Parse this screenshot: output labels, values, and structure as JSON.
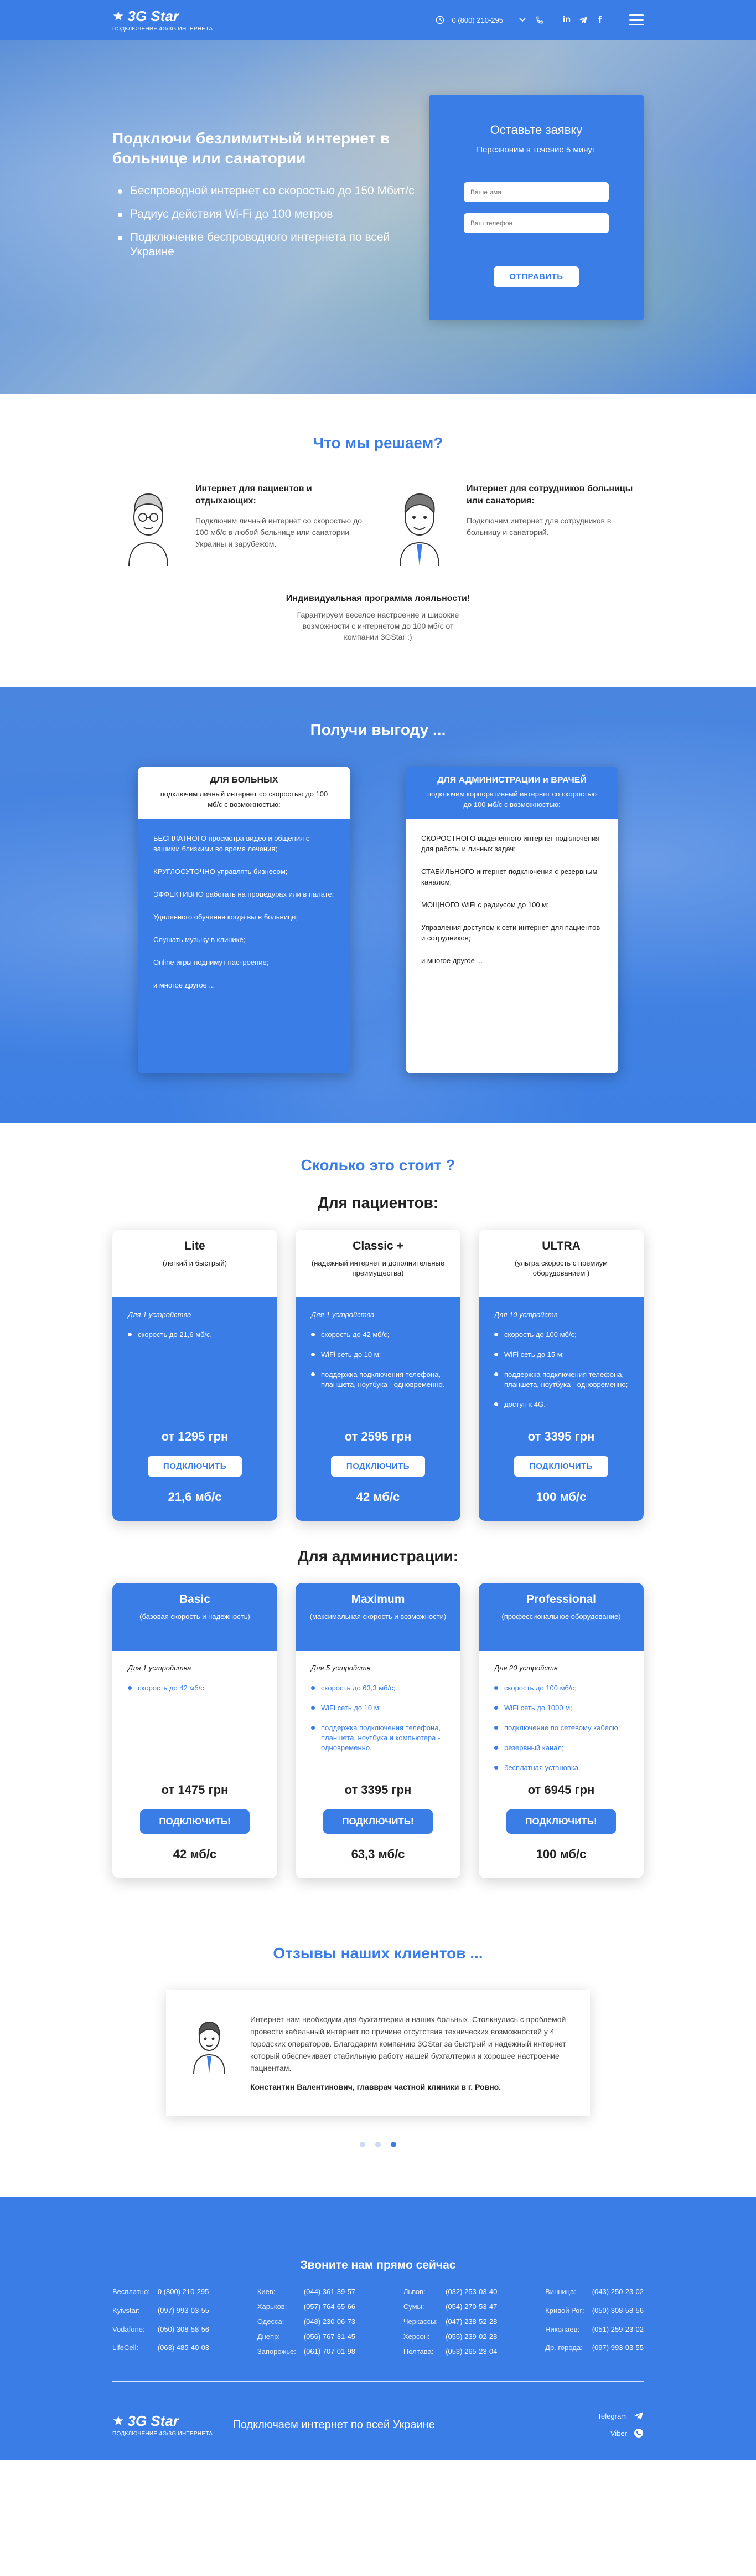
{
  "header": {
    "logo": "3G Star",
    "logo_sub": "ПОДКЛЮЧЕНИЕ 4G/3G ИНТЕРНЕТА",
    "phone": "0 (800) 210-295",
    "colors": {
      "primary": "#3a7de6"
    }
  },
  "hero": {
    "title": "Подключи безлимитный интернет в больнице или санатории",
    "bullets": [
      "Беспроводной интернет со скоростью до 150 Мбит/с",
      "Радиус действия Wi-Fi до 100 метров",
      "Подключение беспроводного интернета по всей Украине"
    ],
    "form": {
      "title": "Оставьте заявку",
      "subtitle": "Перезвоним в течение 5 минут",
      "name_placeholder": "Ваше имя",
      "phone_placeholder": "Ваш телефон",
      "submit": "ОТПРАВИТЬ"
    }
  },
  "solve": {
    "title": "Что мы решаем?",
    "items": [
      {
        "title": "Интернет для пациентов и отдыхающих:",
        "text": "Подключим личный интернет со скоростью до 100 мб/с в любой больнице или санатории Украины и зарубежом."
      },
      {
        "title": "Интернет для сотрудников больницы или санатория:",
        "text": "Подключим интернет для сотрудников в больницу и санаторий."
      }
    ],
    "loyalty_title": "Индивидуальная программа лояльности!",
    "loyalty_text": "Гарантируем веселое настроение и широкие возможности с интернетом до 100 мб/с от компании 3GStar :)"
  },
  "benefits": {
    "title": "Получи выгоду ...",
    "left": {
      "title": "ДЛЯ БОЛЬНЫХ",
      "subtitle": "подключим личный интернет со скоростью до 100 мб/с с возможностью:",
      "items": [
        "БЕСПЛАТНОГО просмотра видео и общения с вашими близкими во время лечения;",
        "КРУГЛОСУТОЧНО управлять бизнесом;",
        "ЭФФЕКТИВНО работать на процедурах или в палате;",
        "Удаленного обучения когда вы в больнице;",
        "Слушать музыку в клинике;",
        "Online игры поднимут настроение;",
        "и многое другое ..."
      ]
    },
    "right": {
      "title": "ДЛЯ АДМИНИСТРАЦИИ и ВРАЧЕЙ",
      "subtitle": "подключим корпоративный интернет со скоростью до 100 мб/с с возможностью:",
      "items": [
        "СКОРОСТНОГО выделенного интернет подключения для работы и личных задач;",
        "СТАБИЛЬНОГО интернет подключения с резервным каналом;",
        "МОЩНОГО WiFi с радиусом до 100 м;",
        "Управления доступом к сети интернет для пациентов и сотрудников;",
        "и многое другое ..."
      ]
    }
  },
  "pricing": {
    "title": "Сколько это стоит ?",
    "patients_title": "Для пациентов:",
    "admin_title": "Для администрации:",
    "button": "ПОДКЛЮЧИТЬ",
    "button_admin": "ПОДКЛЮЧИТЬ!",
    "patients": [
      {
        "name": "Lite",
        "desc": "(легкий и быстрый)",
        "devices": "Для 1 устройства",
        "features": [
          "скорость до 21,6 мб/с."
        ],
        "price": "от 1295 грн",
        "speed": "21,6 мб/с"
      },
      {
        "name": "Classic +",
        "desc": "(надежный интернет и дополнительные преимущества)",
        "devices": "Для 1 устройства",
        "features": [
          "скорость до 42 мб/с;",
          "WiFi сеть до 10 м;",
          "поддержка подключения телефона, планшета, ноутбука - одновременно."
        ],
        "price": "от 2595 грн",
        "speed": "42 мб/с"
      },
      {
        "name": "ULTRA",
        "desc": "(ультра скорость с премиум оборудованием )",
        "devices": "Для 10 устройств",
        "features": [
          "скорость до 100 мб/с;",
          "WiFi сеть до 15 м;",
          "поддержка подключения телефона, планшета, ноутбука - одновременно;",
          "доступ к 4G."
        ],
        "price": "от 3395 грн",
        "speed": "100 мб/с"
      }
    ],
    "admin": [
      {
        "name": "Basic",
        "desc": "(базовая скорость и надежность)",
        "devices": "Для 1 устройства",
        "features": [
          "скорость до 42 мб/с."
        ],
        "price": "от 1475 грн",
        "speed": "42 мб/с"
      },
      {
        "name": "Maximum",
        "desc": "(максимальная скорость и возможности)",
        "devices": "Для 5 устройств",
        "features": [
          "скорость до 63,3 мб/с;",
          "WiFi сеть до 10 м;",
          "поддержка подключения телефона, планшета, ноутбука и компьютера - одновременно."
        ],
        "price": "от 3395 грн",
        "speed": "63,3 мб/с"
      },
      {
        "name": "Professional",
        "desc": "(профессиональное оборудование)",
        "devices": "Для 20 устройств",
        "features": [
          "скорость до 100 мб/с;",
          "WiFi сеть до 1000 м;",
          "подключение по сетевому кабелю;",
          "резервный канал;",
          "бесплатная установка."
        ],
        "price": "от 6945 грн",
        "speed": "100 мб/с"
      }
    ]
  },
  "reviews": {
    "title": "Отзывы наших клиентов ...",
    "text": "Интернет нам необходим для бухгалтерии и наших больных. Столкнулись с проблемой провести кабельный интернет по причине отсутствия технических возможностей у 4 городских операторов. Благодарим компанию 3GStar за быстрый и надежный интернет который обеспечивает стабильную работу нашей бухгалтерии и хорошее настроение пациентам.",
    "author": "Константин Валентинович, главврач частной клиники в г. Ровно."
  },
  "contacts": {
    "title": "Звоните нам прямо сейчас",
    "col1": [
      [
        "Бесплатно:",
        "0 (800) 210-295"
      ],
      [
        "Kyivstar:",
        "(097) 993-03-55"
      ],
      [
        "Vodafone:",
        "(050) 308-58-56"
      ],
      [
        "LifeCell:",
        "(063) 485-40-03"
      ]
    ],
    "col2": [
      [
        "Киев:",
        "(044) 361-39-57"
      ],
      [
        "Харьков:",
        "(057) 764-65-66"
      ],
      [
        "Одесса:",
        "(048) 230-06-73"
      ],
      [
        "Днепр:",
        "(056) 767-31-45"
      ],
      [
        "Запорожье:",
        "(061) 707-01-98"
      ]
    ],
    "col3": [
      [
        "Львов:",
        "(032) 253-03-40"
      ],
      [
        "Сумы:",
        "(054) 270-53-47"
      ],
      [
        "Черкассы:",
        "(047) 238-52-28"
      ],
      [
        "Херсон:",
        "(055) 239-02-28"
      ],
      [
        "Полтава:",
        "(053) 265-23-04"
      ]
    ],
    "col4": [
      [
        "Винница:",
        "(043) 250-23-02"
      ],
      [
        "Кривой Рог:",
        "(050) 308-58-56"
      ],
      [
        "Николаев:",
        "(051) 259-23-02"
      ],
      [
        "Др. города:",
        "(097) 993-03-55"
      ]
    ],
    "slogan": "Подключаем интернет по всей Украине",
    "telegram": "Telegram",
    "viber": "Viber"
  }
}
